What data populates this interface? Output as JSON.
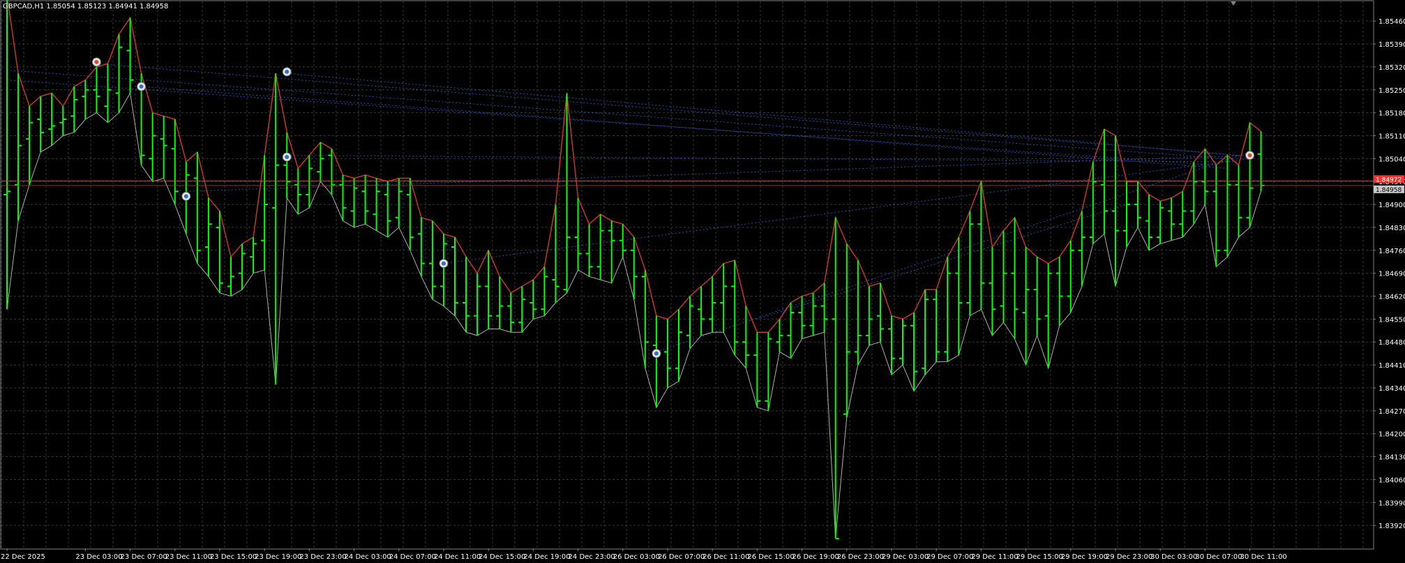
{
  "chart_data": {
    "type": "ohlc",
    "title": "GBPCAD,H1  1.85054 1.85123 1.84941 1.84958",
    "symbol": "GBPCAD",
    "timeframe": "H1",
    "ohlc_header": {
      "open": "1.85054",
      "high": "1.85123",
      "low": "1.84941",
      "close": "1.84958"
    },
    "bar_color": "#00ff00",
    "background": "#000000",
    "grid": true,
    "grid_color": "#3a3a3a",
    "upper_band_color": "#c0392b",
    "lower_band_color": "#b0b0b0",
    "trend_line_color": "#3060c8",
    "ylim": [
      1.8385,
      1.8552
    ],
    "y_ticks": [
      "1.85460",
      "1.85390",
      "1.85320",
      "1.85250",
      "1.85180",
      "1.85110",
      "1.85040",
      "1.84970",
      "1.84900",
      "1.84830",
      "1.84760",
      "1.84690",
      "1.84620",
      "1.84550",
      "1.84480",
      "1.84410",
      "1.84340",
      "1.84270",
      "1.84200",
      "1.84130",
      "1.84060",
      "1.83990",
      "1.83920"
    ],
    "y_tick_values": [
      1.8546,
      1.8539,
      1.8532,
      1.8525,
      1.8518,
      1.8511,
      1.8504,
      1.8497,
      1.849,
      1.8483,
      1.8476,
      1.8469,
      1.8462,
      1.8455,
      1.8448,
      1.8441,
      1.8434,
      1.8427,
      1.842,
      1.8413,
      1.8406,
      1.8399,
      1.8392
    ],
    "x_ticks": [
      {
        "bar": 0,
        "label": "22 Dec 2025"
      },
      {
        "bar": 7,
        "label": "23 Dec 03:00"
      },
      {
        "bar": 11,
        "label": "23 Dec 07:00"
      },
      {
        "bar": 15,
        "label": "23 Dec 11:00"
      },
      {
        "bar": 19,
        "label": "23 Dec 15:00"
      },
      {
        "bar": 23,
        "label": "23 Dec 19:00"
      },
      {
        "bar": 27,
        "label": "23 Dec 23:00"
      },
      {
        "bar": 31,
        "label": "24 Dec 03:00"
      },
      {
        "bar": 35,
        "label": "24 Dec 07:00"
      },
      {
        "bar": 39,
        "label": "24 Dec 11:00"
      },
      {
        "bar": 43,
        "label": "24 Dec 15:00"
      },
      {
        "bar": 47,
        "label": "24 Dec 19:00"
      },
      {
        "bar": 51,
        "label": "24 Dec 23:00"
      },
      {
        "bar": 55,
        "label": "26 Dec 03:00"
      },
      {
        "bar": 59,
        "label": "26 Dec 07:00"
      },
      {
        "bar": 63,
        "label": "26 Dec 11:00"
      },
      {
        "bar": 67,
        "label": "26 Dec 15:00"
      },
      {
        "bar": 71,
        "label": "26 Dec 19:00"
      },
      {
        "bar": 75,
        "label": "26 Dec 23:00"
      },
      {
        "bar": 79,
        "label": "29 Dec 03:00"
      },
      {
        "bar": 83,
        "label": "29 Dec 07:00"
      },
      {
        "bar": 87,
        "label": "29 Dec 11:00"
      },
      {
        "bar": 91,
        "label": "29 Dec 15:00"
      },
      {
        "bar": 95,
        "label": "29 Dec 19:00"
      },
      {
        "bar": 99,
        "label": "29 Dec 23:00"
      },
      {
        "bar": 103,
        "label": "30 Dec 03:00"
      },
      {
        "bar": 107,
        "label": "30 Dec 07:00"
      },
      {
        "bar": 111,
        "label": "30 Dec 11:00"
      }
    ],
    "bid_line": {
      "value": 1.84958,
      "label": "1.84958",
      "color": "#c0392b"
    },
    "ask_line": {
      "value": 1.84972,
      "label": "1.84972",
      "color": "#ff3030"
    },
    "bars": [
      {
        "o": 1.8493,
        "h": 1.8554,
        "l": 1.8458,
        "c": 1.8494
      },
      {
        "o": 1.8496,
        "h": 1.853,
        "l": 1.8485,
        "c": 1.8508
      },
      {
        "o": 1.851,
        "h": 1.852,
        "l": 1.8496,
        "c": 1.8515
      },
      {
        "o": 1.8516,
        "h": 1.8523,
        "l": 1.8506,
        "c": 1.8512
      },
      {
        "o": 1.8513,
        "h": 1.8524,
        "l": 1.8508,
        "c": 1.8514
      },
      {
        "o": 1.8515,
        "h": 1.852,
        "l": 1.8511,
        "c": 1.8516
      },
      {
        "o": 1.8517,
        "h": 1.8526,
        "l": 1.8512,
        "c": 1.8522
      },
      {
        "o": 1.8523,
        "h": 1.8528,
        "l": 1.8516,
        "c": 1.8525
      },
      {
        "o": 1.8525,
        "h": 1.8532,
        "l": 1.8518,
        "c": 1.8523
      },
      {
        "o": 1.852,
        "h": 1.8533,
        "l": 1.8515,
        "c": 1.8525
      },
      {
        "o": 1.8524,
        "h": 1.8542,
        "l": 1.8518,
        "c": 1.8538
      },
      {
        "o": 1.8537,
        "h": 1.8547,
        "l": 1.8524,
        "c": 1.8528
      },
      {
        "o": 1.8526,
        "h": 1.853,
        "l": 1.8502,
        "c": 1.8505
      },
      {
        "o": 1.8504,
        "h": 1.8518,
        "l": 1.8497,
        "c": 1.8511
      },
      {
        "o": 1.851,
        "h": 1.8517,
        "l": 1.8498,
        "c": 1.8508
      },
      {
        "o": 1.8507,
        "h": 1.8516,
        "l": 1.849,
        "c": 1.8494
      },
      {
        "o": 1.8493,
        "h": 1.8503,
        "l": 1.8481,
        "c": 1.8499
      },
      {
        "o": 1.8498,
        "h": 1.8506,
        "l": 1.8472,
        "c": 1.8476
      },
      {
        "o": 1.8477,
        "h": 1.8492,
        "l": 1.8468,
        "c": 1.8484
      },
      {
        "o": 1.8483,
        "h": 1.8488,
        "l": 1.8463,
        "c": 1.8466
      },
      {
        "o": 1.8465,
        "h": 1.8474,
        "l": 1.8462,
        "c": 1.8468
      },
      {
        "o": 1.8469,
        "h": 1.8478,
        "l": 1.8464,
        "c": 1.8475
      },
      {
        "o": 1.8474,
        "h": 1.848,
        "l": 1.8469,
        "c": 1.8478
      },
      {
        "o": 1.8479,
        "h": 1.8505,
        "l": 1.847,
        "c": 1.849
      },
      {
        "o": 1.8489,
        "h": 1.853,
        "l": 1.8435,
        "c": 1.8502
      },
      {
        "o": 1.8502,
        "h": 1.8512,
        "l": 1.8492,
        "c": 1.8497
      },
      {
        "o": 1.8496,
        "h": 1.8501,
        "l": 1.8487,
        "c": 1.8493
      },
      {
        "o": 1.8493,
        "h": 1.8505,
        "l": 1.8489,
        "c": 1.8501
      },
      {
        "o": 1.85,
        "h": 1.8509,
        "l": 1.8497,
        "c": 1.8504
      },
      {
        "o": 1.8505,
        "h": 1.8507,
        "l": 1.8493,
        "c": 1.8496
      },
      {
        "o": 1.8496,
        "h": 1.8499,
        "l": 1.8485,
        "c": 1.8489
      },
      {
        "o": 1.8488,
        "h": 1.8498,
        "l": 1.8483,
        "c": 1.8495
      },
      {
        "o": 1.8494,
        "h": 1.8499,
        "l": 1.8484,
        "c": 1.8488
      },
      {
        "o": 1.8487,
        "h": 1.8498,
        "l": 1.8482,
        "c": 1.8494
      },
      {
        "o": 1.8493,
        "h": 1.8497,
        "l": 1.848,
        "c": 1.8485
      },
      {
        "o": 1.8486,
        "h": 1.8498,
        "l": 1.8483,
        "c": 1.8494
      },
      {
        "o": 1.8493,
        "h": 1.8498,
        "l": 1.8476,
        "c": 1.848
      },
      {
        "o": 1.8481,
        "h": 1.8486,
        "l": 1.8468,
        "c": 1.8472
      },
      {
        "o": 1.8472,
        "h": 1.8485,
        "l": 1.8461,
        "c": 1.8465
      },
      {
        "o": 1.8465,
        "h": 1.8481,
        "l": 1.8459,
        "c": 1.8478
      },
      {
        "o": 1.8477,
        "h": 1.848,
        "l": 1.8456,
        "c": 1.846
      },
      {
        "o": 1.846,
        "h": 1.8474,
        "l": 1.8451,
        "c": 1.8456
      },
      {
        "o": 1.8456,
        "h": 1.8469,
        "l": 1.845,
        "c": 1.8465
      },
      {
        "o": 1.8465,
        "h": 1.8476,
        "l": 1.8452,
        "c": 1.8456
      },
      {
        "o": 1.8456,
        "h": 1.8468,
        "l": 1.8452,
        "c": 1.8459
      },
      {
        "o": 1.8459,
        "h": 1.8463,
        "l": 1.8451,
        "c": 1.8454
      },
      {
        "o": 1.8454,
        "h": 1.8465,
        "l": 1.8451,
        "c": 1.8461
      },
      {
        "o": 1.846,
        "h": 1.8467,
        "l": 1.8455,
        "c": 1.8458
      },
      {
        "o": 1.8458,
        "h": 1.8471,
        "l": 1.8456,
        "c": 1.8468
      },
      {
        "o": 1.8467,
        "h": 1.849,
        "l": 1.846,
        "c": 1.8465
      },
      {
        "o": 1.8464,
        "h": 1.8524,
        "l": 1.8463,
        "c": 1.848
      },
      {
        "o": 1.848,
        "h": 1.8492,
        "l": 1.847,
        "c": 1.8475
      },
      {
        "o": 1.8475,
        "h": 1.8484,
        "l": 1.8468,
        "c": 1.8471
      },
      {
        "o": 1.8471,
        "h": 1.8487,
        "l": 1.8467,
        "c": 1.8482
      },
      {
        "o": 1.8482,
        "h": 1.8485,
        "l": 1.8466,
        "c": 1.8479
      },
      {
        "o": 1.8479,
        "h": 1.8484,
        "l": 1.8474,
        "c": 1.8476
      },
      {
        "o": 1.8476,
        "h": 1.848,
        "l": 1.8461,
        "c": 1.8468
      },
      {
        "o": 1.8468,
        "h": 1.847,
        "l": 1.844,
        "c": 1.8448
      },
      {
        "o": 1.8447,
        "h": 1.8456,
        "l": 1.8428,
        "c": 1.8445
      },
      {
        "o": 1.8445,
        "h": 1.8455,
        "l": 1.8434,
        "c": 1.844
      },
      {
        "o": 1.844,
        "h": 1.8458,
        "l": 1.8436,
        "c": 1.8451
      },
      {
        "o": 1.845,
        "h": 1.8462,
        "l": 1.8446,
        "c": 1.8459
      },
      {
        "o": 1.8458,
        "h": 1.8465,
        "l": 1.845,
        "c": 1.8455
      },
      {
        "o": 1.8455,
        "h": 1.8468,
        "l": 1.8451,
        "c": 1.846
      },
      {
        "o": 1.846,
        "h": 1.8472,
        "l": 1.8451,
        "c": 1.8465
      },
      {
        "o": 1.8465,
        "h": 1.8473,
        "l": 1.8444,
        "c": 1.8448
      },
      {
        "o": 1.8448,
        "h": 1.8459,
        "l": 1.844,
        "c": 1.8444
      },
      {
        "o": 1.8444,
        "h": 1.8451,
        "l": 1.8428,
        "c": 1.843
      },
      {
        "o": 1.843,
        "h": 1.8451,
        "l": 1.8427,
        "c": 1.8449
      },
      {
        "o": 1.8448,
        "h": 1.8455,
        "l": 1.8445,
        "c": 1.845
      },
      {
        "o": 1.845,
        "h": 1.846,
        "l": 1.8443,
        "c": 1.8457
      },
      {
        "o": 1.8457,
        "h": 1.8462,
        "l": 1.8449,
        "c": 1.8453
      },
      {
        "o": 1.8453,
        "h": 1.8463,
        "l": 1.845,
        "c": 1.8459
      },
      {
        "o": 1.8459,
        "h": 1.8466,
        "l": 1.8451,
        "c": 1.8455
      },
      {
        "o": 1.8455,
        "h": 1.8486,
        "l": 1.8388,
        "c": 1.8388
      },
      {
        "o": 1.8426,
        "h": 1.8478,
        "l": 1.8425,
        "c": 1.8445
      },
      {
        "o": 1.8445,
        "h": 1.8473,
        "l": 1.8441,
        "c": 1.845
      },
      {
        "o": 1.845,
        "h": 1.8465,
        "l": 1.8447,
        "c": 1.8455
      },
      {
        "o": 1.8456,
        "h": 1.8466,
        "l": 1.8448,
        "c": 1.8452
      },
      {
        "o": 1.8452,
        "h": 1.8456,
        "l": 1.8438,
        "c": 1.8443
      },
      {
        "o": 1.8443,
        "h": 1.8455,
        "l": 1.8441,
        "c": 1.8453
      },
      {
        "o": 1.8453,
        "h": 1.8457,
        "l": 1.8433,
        "c": 1.8439
      },
      {
        "o": 1.844,
        "h": 1.8464,
        "l": 1.8438,
        "c": 1.8461
      },
      {
        "o": 1.8461,
        "h": 1.8464,
        "l": 1.8442,
        "c": 1.8445
      },
      {
        "o": 1.8445,
        "h": 1.8474,
        "l": 1.8442,
        "c": 1.8469
      },
      {
        "o": 1.8469,
        "h": 1.848,
        "l": 1.8444,
        "c": 1.846
      },
      {
        "o": 1.846,
        "h": 1.8488,
        "l": 1.8456,
        "c": 1.8484
      },
      {
        "o": 1.8484,
        "h": 1.8497,
        "l": 1.8458,
        "c": 1.8466
      },
      {
        "o": 1.8466,
        "h": 1.8477,
        "l": 1.845,
        "c": 1.8458
      },
      {
        "o": 1.8459,
        "h": 1.8482,
        "l": 1.8454,
        "c": 1.8469
      },
      {
        "o": 1.8469,
        "h": 1.8486,
        "l": 1.8449,
        "c": 1.8458
      },
      {
        "o": 1.8457,
        "h": 1.8477,
        "l": 1.8441,
        "c": 1.8464
      },
      {
        "o": 1.8464,
        "h": 1.8474,
        "l": 1.845,
        "c": 1.8455
      },
      {
        "o": 1.8456,
        "h": 1.8472,
        "l": 1.844,
        "c": 1.8469
      },
      {
        "o": 1.8469,
        "h": 1.8474,
        "l": 1.8453,
        "c": 1.8462
      },
      {
        "o": 1.8462,
        "h": 1.8479,
        "l": 1.8457,
        "c": 1.8476
      },
      {
        "o": 1.8476,
        "h": 1.8488,
        "l": 1.8465,
        "c": 1.848
      },
      {
        "o": 1.848,
        "h": 1.8503,
        "l": 1.8478,
        "c": 1.8497
      },
      {
        "o": 1.8496,
        "h": 1.8513,
        "l": 1.8481,
        "c": 1.8488
      },
      {
        "o": 1.8488,
        "h": 1.8511,
        "l": 1.8465,
        "c": 1.8482
      },
      {
        "o": 1.8482,
        "h": 1.8497,
        "l": 1.8477,
        "c": 1.849
      },
      {
        "o": 1.849,
        "h": 1.8497,
        "l": 1.8483,
        "c": 1.8486
      },
      {
        "o": 1.8485,
        "h": 1.8493,
        "l": 1.8476,
        "c": 1.848
      },
      {
        "o": 1.848,
        "h": 1.8491,
        "l": 1.8478,
        "c": 1.8489
      },
      {
        "o": 1.8488,
        "h": 1.8492,
        "l": 1.8479,
        "c": 1.8484
      },
      {
        "o": 1.8484,
        "h": 1.8494,
        "l": 1.848,
        "c": 1.8488
      },
      {
        "o": 1.8488,
        "h": 1.8503,
        "l": 1.8484,
        "c": 1.8497
      },
      {
        "o": 1.8497,
        "h": 1.8507,
        "l": 1.849,
        "c": 1.8494
      },
      {
        "o": 1.8494,
        "h": 1.8502,
        "l": 1.8471,
        "c": 1.8476
      },
      {
        "o": 1.8476,
        "h": 1.8505,
        "l": 1.8474,
        "c": 1.8496
      },
      {
        "o": 1.8496,
        "h": 1.8502,
        "l": 1.848,
        "c": 1.8486
      },
      {
        "o": 1.8486,
        "h": 1.8515,
        "l": 1.8483,
        "c": 1.8495
      },
      {
        "o": 1.85054,
        "h": 1.85123,
        "l": 1.84941,
        "c": 1.84958
      }
    ],
    "trend_lines": [
      {
        "b1": 0,
        "p1": 1.8531,
        "b2": 109,
        "p2": 1.8504
      },
      {
        "b1": 0,
        "p1": 1.8528,
        "b2": 108,
        "p2": 1.8502
      },
      {
        "b1": 8,
        "p1": 1.8533,
        "b2": 110,
        "p2": 1.8505
      },
      {
        "b1": 12,
        "p1": 1.8526,
        "b2": 109,
        "p2": 1.8501
      },
      {
        "b1": 25,
        "p1": 1.853,
        "b2": 110,
        "p2": 1.8505
      },
      {
        "b1": 25,
        "p1": 1.8505,
        "b2": 110,
        "p2": 1.8503
      },
      {
        "b1": 16,
        "p1": 1.8494,
        "b2": 111,
        "p2": 1.8505
      },
      {
        "b1": 39,
        "p1": 1.8472,
        "b2": 111,
        "p2": 1.8504
      },
      {
        "b1": 58,
        "p1": 1.8445,
        "b2": 111,
        "p2": 1.8506
      },
      {
        "b1": 67,
        "p1": 1.8455,
        "b2": 100,
        "p2": 1.849
      }
    ],
    "markers": [
      {
        "bar": 8,
        "price": 1.85335,
        "kind": "sell"
      },
      {
        "bar": 12,
        "price": 1.8526,
        "kind": "buy"
      },
      {
        "bar": 25,
        "price": 1.85305,
        "kind": "buy"
      },
      {
        "bar": 25,
        "price": 1.85045,
        "kind": "buy"
      },
      {
        "bar": 16,
        "price": 1.84925,
        "kind": "buy"
      },
      {
        "bar": 39,
        "price": 1.8472,
        "kind": "buy"
      },
      {
        "bar": 58,
        "price": 1.84445,
        "kind": "buy"
      },
      {
        "bar": 111,
        "price": 1.8505,
        "kind": "sell"
      }
    ]
  }
}
